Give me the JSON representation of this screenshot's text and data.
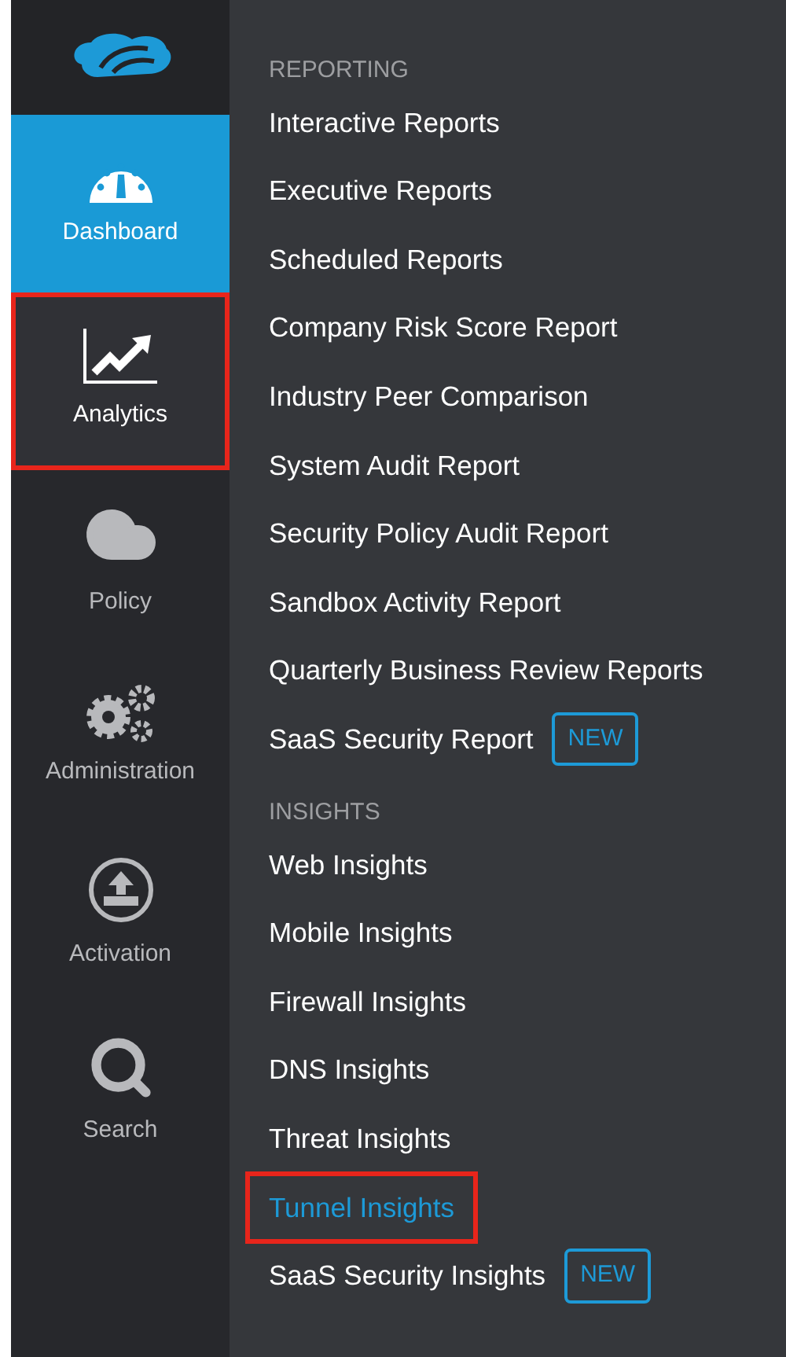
{
  "nav": [
    {
      "kind": "dashboard",
      "label": "Dashboard",
      "selected": true,
      "highlighted": false
    },
    {
      "kind": "analytics",
      "label": "Analytics",
      "selected": false,
      "highlighted": true
    },
    {
      "kind": "policy",
      "label": "Policy",
      "selected": false,
      "highlighted": false
    },
    {
      "kind": "administration",
      "label": "Administration",
      "selected": false,
      "highlighted": false
    },
    {
      "kind": "activation",
      "label": "Activation",
      "selected": false,
      "highlighted": false
    },
    {
      "kind": "search",
      "label": "Search",
      "selected": false,
      "highlighted": false
    }
  ],
  "menu": [
    {
      "heading": "REPORTING",
      "items": [
        {
          "label": "Interactive Reports",
          "selected": false,
          "highlighted": false
        },
        {
          "label": "Executive Reports",
          "selected": false,
          "highlighted": false
        },
        {
          "label": "Scheduled Reports",
          "selected": false,
          "highlighted": false
        },
        {
          "label": "Company Risk Score Report",
          "selected": false,
          "highlighted": false
        },
        {
          "label": "Industry Peer Comparison",
          "selected": false,
          "highlighted": false
        },
        {
          "label": "System Audit Report",
          "selected": false,
          "highlighted": false
        },
        {
          "label": "Security Policy Audit Report",
          "selected": false,
          "highlighted": false
        },
        {
          "label": "Sandbox Activity Report",
          "selected": false,
          "highlighted": false
        },
        {
          "label": "Quarterly Business Review Reports",
          "selected": false,
          "highlighted": false
        },
        {
          "label": "SaaS Security Report",
          "badge": "NEW",
          "selected": false,
          "highlighted": false
        }
      ]
    },
    {
      "heading": "INSIGHTS",
      "items": [
        {
          "label": "Web Insights",
          "selected": false,
          "highlighted": false
        },
        {
          "label": "Mobile Insights",
          "selected": false,
          "highlighted": false
        },
        {
          "label": "Firewall Insights",
          "selected": false,
          "highlighted": false
        },
        {
          "label": "DNS Insights",
          "selected": false,
          "highlighted": false
        },
        {
          "label": "Threat Insights",
          "selected": false,
          "highlighted": false
        },
        {
          "label": "Tunnel Insights",
          "selected": true,
          "highlighted": true
        },
        {
          "label": "SaaS Security Insights",
          "badge": "NEW",
          "selected": false,
          "highlighted": false
        }
      ]
    }
  ]
}
